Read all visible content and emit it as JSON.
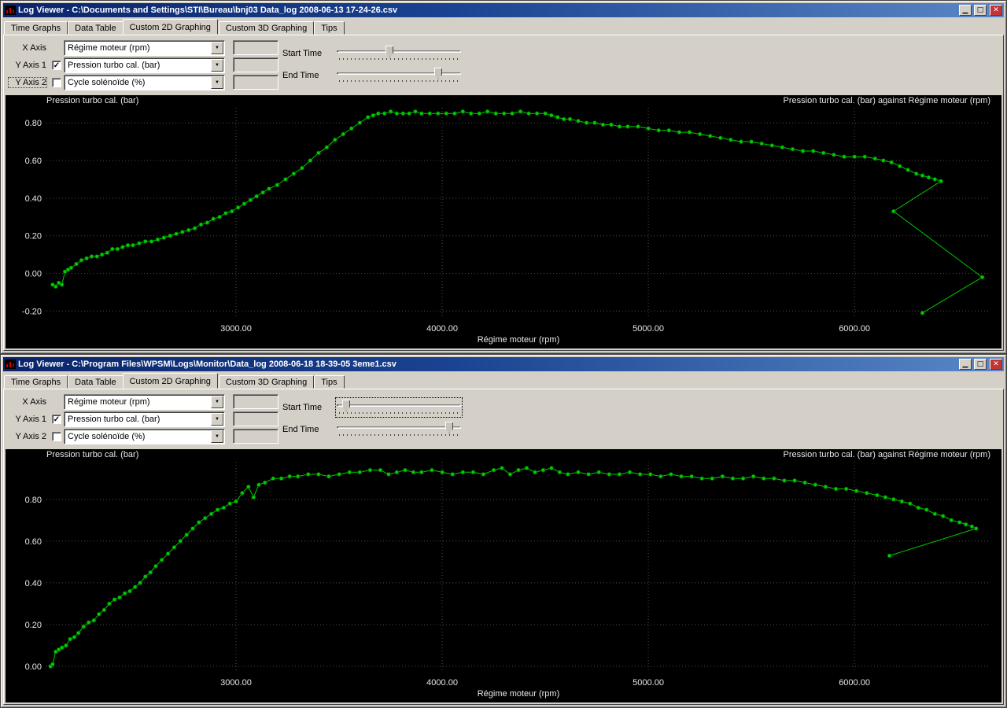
{
  "icons": {
    "minimize": "▁",
    "maximize": "□",
    "close": "✕",
    "dropdown": "▼",
    "checked": "✓"
  },
  "windows": [
    {
      "title": "Log Viewer - C:\\Documents and Settings\\STI\\Bureau\\bnj03 Data_log 2008-06-13 17-24-26.csv",
      "tabs": [
        "Time Graphs",
        "Data Table",
        "Custom 2D Graphing",
        "Custom 3D Graphing",
        "Tips"
      ],
      "active_tab": "Custom 2D Graphing",
      "controls": {
        "x_label": "X Axis",
        "x_value": "Régime moteur (rpm)",
        "y1_label": "Y Axis 1",
        "y1_checked": true,
        "y1_value": "Pression turbo cal. (bar)",
        "y2_label": "Y Axis 2",
        "y2_checked": false,
        "y2_value": "Cycle solénoïde (%)",
        "start_label": "Start Time",
        "start_pos": 0.42,
        "end_label": "End Time",
        "end_pos": 0.84
      },
      "chart_data": {
        "type": "line",
        "title_left": "Pression turbo cal. (bar)",
        "title_right": "Pression turbo cal. (bar) against Régime moteur (rpm)",
        "xlabel": "Régime moteur (rpm)",
        "xlim": [
          2080,
          6660
        ],
        "ylim": [
          -0.24,
          0.88
        ],
        "xticks": [
          3000,
          4000,
          5000,
          6000
        ],
        "yticks": [
          -0.2,
          0.0,
          0.2,
          0.4,
          0.6,
          0.8
        ],
        "line_color": "#00cc00",
        "grid": true,
        "legend": "none",
        "points": [
          [
            2110,
            -0.06
          ],
          [
            2125,
            -0.07
          ],
          [
            2140,
            -0.05
          ],
          [
            2155,
            -0.06
          ],
          [
            2170,
            0.01
          ],
          [
            2185,
            0.02
          ],
          [
            2200,
            0.03
          ],
          [
            2225,
            0.05
          ],
          [
            2250,
            0.07
          ],
          [
            2275,
            0.08
          ],
          [
            2300,
            0.09
          ],
          [
            2325,
            0.09
          ],
          [
            2350,
            0.1
          ],
          [
            2375,
            0.11
          ],
          [
            2400,
            0.13
          ],
          [
            2425,
            0.13
          ],
          [
            2450,
            0.14
          ],
          [
            2475,
            0.15
          ],
          [
            2500,
            0.15
          ],
          [
            2530,
            0.16
          ],
          [
            2560,
            0.17
          ],
          [
            2590,
            0.17
          ],
          [
            2620,
            0.18
          ],
          [
            2650,
            0.19
          ],
          [
            2680,
            0.2
          ],
          [
            2710,
            0.21
          ],
          [
            2740,
            0.22
          ],
          [
            2770,
            0.23
          ],
          [
            2800,
            0.24
          ],
          [
            2830,
            0.26
          ],
          [
            2860,
            0.27
          ],
          [
            2890,
            0.29
          ],
          [
            2920,
            0.3
          ],
          [
            2950,
            0.32
          ],
          [
            2980,
            0.33
          ],
          [
            3010,
            0.35
          ],
          [
            3040,
            0.37
          ],
          [
            3070,
            0.39
          ],
          [
            3100,
            0.41
          ],
          [
            3130,
            0.43
          ],
          [
            3160,
            0.45
          ],
          [
            3200,
            0.47
          ],
          [
            3240,
            0.5
          ],
          [
            3280,
            0.53
          ],
          [
            3320,
            0.56
          ],
          [
            3360,
            0.6
          ],
          [
            3400,
            0.64
          ],
          [
            3440,
            0.67
          ],
          [
            3480,
            0.71
          ],
          [
            3520,
            0.74
          ],
          [
            3560,
            0.77
          ],
          [
            3600,
            0.8
          ],
          [
            3640,
            0.83
          ],
          [
            3665,
            0.84
          ],
          [
            3690,
            0.85
          ],
          [
            3720,
            0.85
          ],
          [
            3750,
            0.86
          ],
          [
            3780,
            0.85
          ],
          [
            3810,
            0.85
          ],
          [
            3840,
            0.85
          ],
          [
            3870,
            0.86
          ],
          [
            3900,
            0.85
          ],
          [
            3940,
            0.85
          ],
          [
            3980,
            0.85
          ],
          [
            4020,
            0.85
          ],
          [
            4060,
            0.85
          ],
          [
            4100,
            0.86
          ],
          [
            4140,
            0.85
          ],
          [
            4180,
            0.85
          ],
          [
            4220,
            0.86
          ],
          [
            4260,
            0.85
          ],
          [
            4300,
            0.85
          ],
          [
            4340,
            0.85
          ],
          [
            4380,
            0.86
          ],
          [
            4420,
            0.85
          ],
          [
            4460,
            0.85
          ],
          [
            4500,
            0.85
          ],
          [
            4530,
            0.84
          ],
          [
            4560,
            0.83
          ],
          [
            4590,
            0.82
          ],
          [
            4620,
            0.82
          ],
          [
            4660,
            0.81
          ],
          [
            4700,
            0.8
          ],
          [
            4740,
            0.8
          ],
          [
            4780,
            0.79
          ],
          [
            4820,
            0.79
          ],
          [
            4860,
            0.78
          ],
          [
            4900,
            0.78
          ],
          [
            4950,
            0.78
          ],
          [
            5000,
            0.77
          ],
          [
            5050,
            0.76
          ],
          [
            5100,
            0.76
          ],
          [
            5150,
            0.75
          ],
          [
            5200,
            0.75
          ],
          [
            5250,
            0.74
          ],
          [
            5300,
            0.73
          ],
          [
            5350,
            0.72
          ],
          [
            5400,
            0.71
          ],
          [
            5450,
            0.7
          ],
          [
            5500,
            0.7
          ],
          [
            5550,
            0.69
          ],
          [
            5600,
            0.68
          ],
          [
            5650,
            0.67
          ],
          [
            5700,
            0.66
          ],
          [
            5750,
            0.65
          ],
          [
            5800,
            0.65
          ],
          [
            5850,
            0.64
          ],
          [
            5900,
            0.63
          ],
          [
            5950,
            0.62
          ],
          [
            6000,
            0.62
          ],
          [
            6050,
            0.62
          ],
          [
            6100,
            0.61
          ],
          [
            6140,
            0.6
          ],
          [
            6180,
            0.59
          ],
          [
            6220,
            0.57
          ],
          [
            6260,
            0.55
          ],
          [
            6300,
            0.53
          ],
          [
            6330,
            0.52
          ],
          [
            6360,
            0.51
          ],
          [
            6390,
            0.5
          ],
          [
            6420,
            0.49
          ],
          [
            6190,
            0.33
          ],
          [
            6620,
            -0.02
          ],
          [
            6330,
            -0.21
          ]
        ]
      }
    },
    {
      "title": "Log Viewer - C:\\Program Files\\WPSM\\Logs\\Monitor\\Data_log 2008-06-18 18-39-05 3eme1.csv",
      "tabs": [
        "Time Graphs",
        "Data Table",
        "Custom 2D Graphing",
        "Custom 3D Graphing",
        "Tips"
      ],
      "active_tab": "Custom 2D Graphing",
      "controls": {
        "x_label": "X Axis",
        "x_value": "Régime moteur (rpm)",
        "y1_label": "Y Axis 1",
        "y1_checked": true,
        "y1_value": "Pression turbo cal. (bar)",
        "y2_label": "Y Axis 2",
        "y2_checked": false,
        "y2_value": "Cycle solénoïde (%)",
        "start_label": "Start Time",
        "start_pos": 0.05,
        "end_label": "End Time",
        "end_pos": 0.93
      },
      "chart_data": {
        "type": "line",
        "title_left": "Pression turbo cal. (bar)",
        "title_right": "Pression turbo cal. (bar) against Régime moteur (rpm)",
        "xlabel": "Régime moteur (rpm)",
        "xlim": [
          2080,
          6660
        ],
        "ylim": [
          -0.03,
          0.98
        ],
        "xticks": [
          3000,
          4000,
          5000,
          6000
        ],
        "yticks": [
          0.0,
          0.2,
          0.4,
          0.6,
          0.8
        ],
        "line_color": "#00cc00",
        "grid": true,
        "legend": "none",
        "points": [
          [
            2100,
            0.0
          ],
          [
            2110,
            0.01
          ],
          [
            2125,
            0.07
          ],
          [
            2140,
            0.08
          ],
          [
            2155,
            0.09
          ],
          [
            2175,
            0.1
          ],
          [
            2195,
            0.13
          ],
          [
            2215,
            0.14
          ],
          [
            2235,
            0.16
          ],
          [
            2260,
            0.19
          ],
          [
            2285,
            0.21
          ],
          [
            2310,
            0.22
          ],
          [
            2335,
            0.25
          ],
          [
            2360,
            0.27
          ],
          [
            2385,
            0.3
          ],
          [
            2410,
            0.32
          ],
          [
            2435,
            0.33
          ],
          [
            2460,
            0.35
          ],
          [
            2485,
            0.36
          ],
          [
            2510,
            0.38
          ],
          [
            2535,
            0.4
          ],
          [
            2560,
            0.43
          ],
          [
            2585,
            0.45
          ],
          [
            2610,
            0.48
          ],
          [
            2640,
            0.51
          ],
          [
            2670,
            0.54
          ],
          [
            2700,
            0.57
          ],
          [
            2730,
            0.6
          ],
          [
            2760,
            0.63
          ],
          [
            2790,
            0.66
          ],
          [
            2820,
            0.69
          ],
          [
            2850,
            0.71
          ],
          [
            2880,
            0.73
          ],
          [
            2910,
            0.75
          ],
          [
            2940,
            0.76
          ],
          [
            2970,
            0.78
          ],
          [
            3000,
            0.79
          ],
          [
            3030,
            0.83
          ],
          [
            3060,
            0.86
          ],
          [
            3085,
            0.81
          ],
          [
            3110,
            0.87
          ],
          [
            3140,
            0.88
          ],
          [
            3180,
            0.9
          ],
          [
            3220,
            0.9
          ],
          [
            3260,
            0.91
          ],
          [
            3300,
            0.91
          ],
          [
            3350,
            0.92
          ],
          [
            3400,
            0.92
          ],
          [
            3450,
            0.91
          ],
          [
            3500,
            0.92
          ],
          [
            3550,
            0.93
          ],
          [
            3600,
            0.93
          ],
          [
            3650,
            0.94
          ],
          [
            3700,
            0.94
          ],
          [
            3740,
            0.92
          ],
          [
            3780,
            0.93
          ],
          [
            3820,
            0.94
          ],
          [
            3860,
            0.93
          ],
          [
            3900,
            0.93
          ],
          [
            3950,
            0.94
          ],
          [
            4000,
            0.93
          ],
          [
            4050,
            0.92
          ],
          [
            4100,
            0.93
          ],
          [
            4150,
            0.93
          ],
          [
            4200,
            0.92
          ],
          [
            4250,
            0.94
          ],
          [
            4290,
            0.95
          ],
          [
            4330,
            0.92
          ],
          [
            4370,
            0.94
          ],
          [
            4410,
            0.95
          ],
          [
            4450,
            0.93
          ],
          [
            4490,
            0.94
          ],
          [
            4530,
            0.95
          ],
          [
            4570,
            0.93
          ],
          [
            4610,
            0.92
          ],
          [
            4660,
            0.93
          ],
          [
            4710,
            0.92
          ],
          [
            4760,
            0.93
          ],
          [
            4810,
            0.92
          ],
          [
            4860,
            0.92
          ],
          [
            4910,
            0.93
          ],
          [
            4960,
            0.92
          ],
          [
            5010,
            0.92
          ],
          [
            5060,
            0.91
          ],
          [
            5110,
            0.92
          ],
          [
            5160,
            0.91
          ],
          [
            5210,
            0.91
          ],
          [
            5260,
            0.9
          ],
          [
            5310,
            0.9
          ],
          [
            5360,
            0.91
          ],
          [
            5410,
            0.9
          ],
          [
            5460,
            0.9
          ],
          [
            5510,
            0.91
          ],
          [
            5560,
            0.9
          ],
          [
            5610,
            0.9
          ],
          [
            5660,
            0.89
          ],
          [
            5710,
            0.89
          ],
          [
            5760,
            0.88
          ],
          [
            5810,
            0.87
          ],
          [
            5860,
            0.86
          ],
          [
            5910,
            0.85
          ],
          [
            5960,
            0.85
          ],
          [
            6010,
            0.84
          ],
          [
            6060,
            0.83
          ],
          [
            6110,
            0.82
          ],
          [
            6150,
            0.81
          ],
          [
            6190,
            0.8
          ],
          [
            6230,
            0.79
          ],
          [
            6270,
            0.78
          ],
          [
            6310,
            0.76
          ],
          [
            6350,
            0.75
          ],
          [
            6390,
            0.73
          ],
          [
            6430,
            0.72
          ],
          [
            6470,
            0.7
          ],
          [
            6510,
            0.69
          ],
          [
            6540,
            0.68
          ],
          [
            6570,
            0.67
          ],
          [
            6590,
            0.66
          ],
          [
            6170,
            0.53
          ]
        ]
      }
    }
  ]
}
